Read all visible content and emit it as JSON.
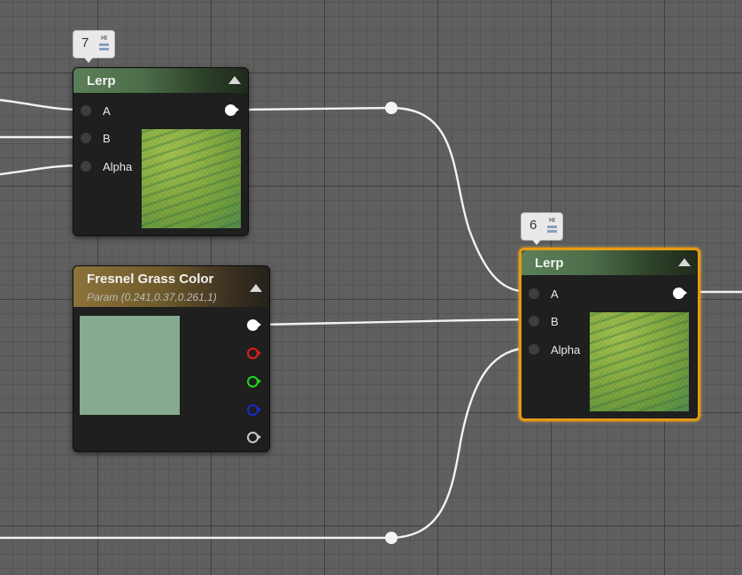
{
  "nodes": {
    "lerp_top": {
      "title": "Lerp",
      "pins": [
        "A",
        "B",
        "Alpha"
      ],
      "badge_count": "7",
      "badge_icon_text": "HI"
    },
    "lerp_bottom": {
      "title": "Lerp",
      "pins": [
        "A",
        "B",
        "Alpha"
      ],
      "badge_count": "6",
      "badge_icon_text": "HI",
      "selected": true
    },
    "fresnel_param": {
      "title": "Fresnel Grass Color",
      "subtitle": "Param (0.241,0.37,0.261,1)",
      "swatch_color": "#86a98f",
      "outputs": [
        "rgba",
        "r",
        "g",
        "b",
        "a"
      ]
    }
  },
  "colors": {
    "lerp_header": "#5c7f58",
    "param_header": "#8b733a",
    "selection_border": "#e49b14",
    "wire": "#f2f2f2",
    "pin_red": "#e81c1c",
    "pin_green": "#1ad81a",
    "pin_blue": "#1a2cc8"
  },
  "icons": {
    "collapse": "triangle-up-icon",
    "reroute": "reroute-dot-icon",
    "badge": "stats-icon"
  }
}
